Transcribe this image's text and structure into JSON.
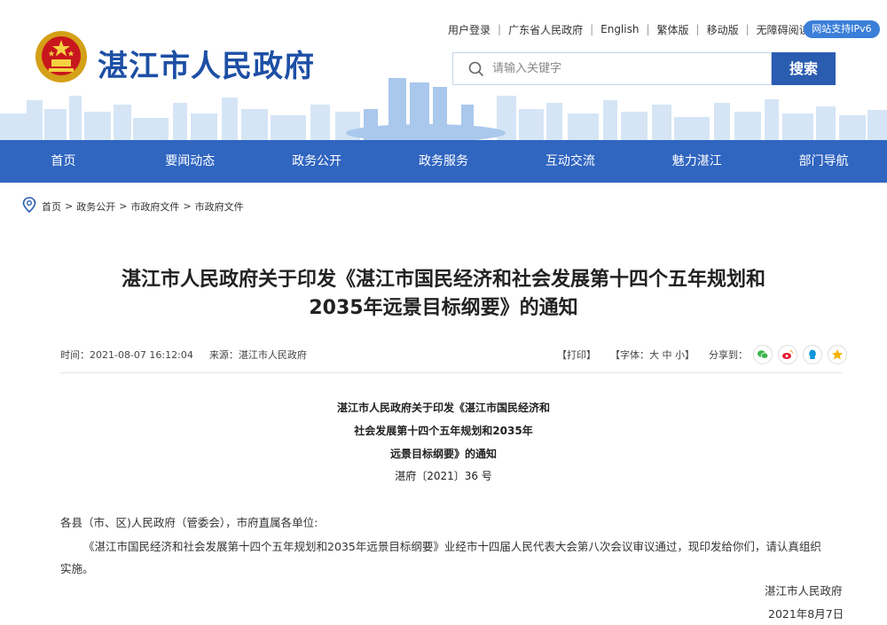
{
  "header": {
    "site_title": "湛江市人民政府",
    "top_links": [
      "用户登录",
      "广东省人民政府",
      "English",
      "繁体版",
      "移动版",
      "无障碍阅读"
    ],
    "ipv6_badge": "网站支持IPv6",
    "search_placeholder": "请输入关键字",
    "search_button": "搜索"
  },
  "nav": {
    "items": [
      "首页",
      "要闻动态",
      "政务公开",
      "政务服务",
      "互动交流",
      "魅力湛江",
      "部门导航"
    ]
  },
  "breadcrumb": [
    "首页",
    "政务公开",
    "市政府文件",
    "市政府文件"
  ],
  "article": {
    "title_line1": "湛江市人民政府关于印发《湛江市国民经济和社会发展第十四个五年规划和",
    "title_line2": "2035年远景目标纲要》的通知",
    "time": "时间：2021-08-07 16:12:04",
    "source": "来源：湛江市人民政府",
    "print": "【打印】",
    "font_size": "【字体：大 中 小】",
    "share_label": "分享到：",
    "doc_title_lines": [
      "湛江市人民政府关于印发《湛江市国民经济和",
      "社会发展第十四个五年规划和2035年",
      "远景目标纲要》的通知"
    ],
    "doc_number": "湛府〔2021〕36 号",
    "salutation": "各县（市、区)人民政府（管委会），市府直属各单位:",
    "para_line1": "《湛江市国民经济和社会发展第十四个五年规划和2035年远景目标纲要》业经市十四届人民代表大会第八次会议审议通过，现印发给你们，请认真组织",
    "para_line2": "实施。",
    "signature": "湛江市人民政府",
    "date": "2021年8月7日"
  },
  "colors": {
    "brand_blue": "#1d4fa5",
    "nav_blue": "#3065c0",
    "button_blue": "#2a5cb0"
  },
  "icons": [
    "emblem",
    "search-icon",
    "location-pin-icon",
    "wechat-icon",
    "weibo-icon",
    "qq-icon",
    "qzone-icon"
  ]
}
